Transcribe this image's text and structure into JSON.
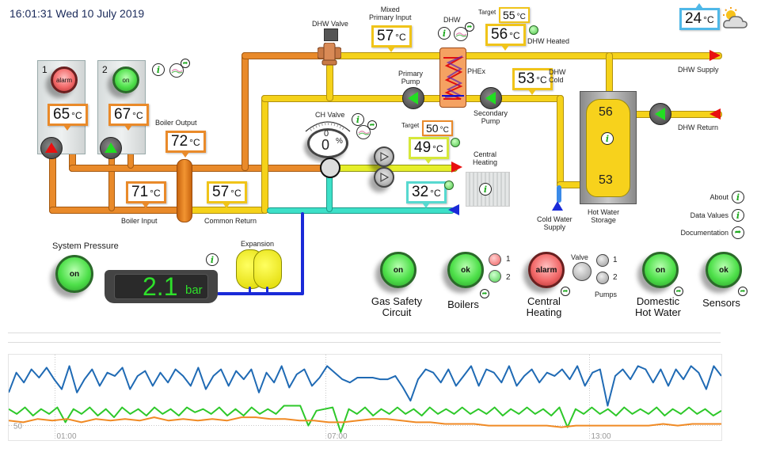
{
  "header": {
    "datetime": "16:01:31 Wed 10 July 2019"
  },
  "weather": {
    "outdoor_temp": "24",
    "unit": "°C",
    "icon": "partly-cloudy-icon"
  },
  "boilers": [
    {
      "number": "1",
      "status": "alarm",
      "temp": "65",
      "unit": "°C",
      "pump": "red-up"
    },
    {
      "number": "2",
      "status": "on",
      "temp": "67",
      "unit": "°C",
      "pump": "green-up"
    }
  ],
  "labels": {
    "boiler_output": "Boiler Output",
    "boiler_input": "Boiler Input",
    "common_return": "Common Return",
    "dhw_valve": "DHW Valve",
    "mixed_primary_input": "Mixed\nPrimary Input",
    "dhw": "DHW",
    "target": "Target",
    "dhw_heated": "DHW Heated",
    "phex": "PHEx",
    "primary_pump": "Primary\nPump",
    "secondary_pump": "Secondary\nPump",
    "dhw_cold": "DHW\nCold",
    "dhw_supply": "DHW Supply",
    "dhw_return": "DHW Return",
    "ch_valve": "CH Valve",
    "central_heating": "Central\nHeating",
    "cold_water_supply": "Cold Water\nSupply",
    "hot_water_storage": "Hot Water\nStorage",
    "expansion": "Expansion",
    "system_pressure": "System Pressure"
  },
  "temps": {
    "boiler_output": "72",
    "boiler_input": "71",
    "common_return": "57",
    "mixed_primary_input": "57",
    "dhw_target": "55",
    "dhw_out": "56",
    "dhw_cold": "53",
    "ch_target": "50",
    "ch_flow": "49",
    "ch_return": "32",
    "tank_top": "56",
    "tank_bottom": "53",
    "unit": "°C"
  },
  "ch_valve": {
    "value_small": "0",
    "value": "0",
    "unit": "%"
  },
  "pressure": {
    "status": "on",
    "value": "2.1",
    "unit": "bar"
  },
  "links": {
    "about": "About",
    "data_values": "Data Values",
    "documentation": "Documentation"
  },
  "status_panel": {
    "gas_safety": {
      "status": "on",
      "label": "Gas Safety\nCircuit"
    },
    "boilers": {
      "status": "ok",
      "label": "Boilers",
      "sub": [
        {
          "n": "1",
          "state": "red"
        },
        {
          "n": "2",
          "state": "green"
        }
      ]
    },
    "central_heating": {
      "status": "alarm",
      "label": "Central\nHeating",
      "valve_label": "Valve",
      "pumps_label": "Pumps",
      "pumps": [
        {
          "n": "1"
        },
        {
          "n": "2"
        }
      ]
    },
    "domestic_hot_water": {
      "status": "on",
      "label": "Domestic\nHot Water"
    },
    "sensors": {
      "status": "ok",
      "label": "Sensors"
    }
  },
  "colors": {
    "boiler_pipe": "#e98a2a",
    "primary_pipe": "#f5d21a",
    "ch_flow_pipe": "#e6ef2a",
    "ch_return_pipe": "#3de0c8",
    "cold_pipe": "#1a2ad8",
    "ok_green": "#4ee04a",
    "alarm_red": "#f26a6a"
  },
  "chart_data": {
    "type": "line",
    "title": "",
    "xlabel": "",
    "ylabel": "",
    "x_tick_labels": [
      "01:00",
      "07:00",
      "13:00"
    ],
    "y_tick_labels": [
      "50"
    ],
    "grid": true,
    "series": [
      {
        "name": "blue",
        "color": "#1f6ab4",
        "values": [
          70,
          82,
          76,
          84,
          79,
          85,
          78,
          72,
          86,
          70,
          78,
          84,
          74,
          82,
          80,
          85,
          72,
          80,
          83,
          74,
          82,
          76,
          84,
          80,
          74,
          85,
          72,
          80,
          84,
          74,
          83,
          78,
          84,
          70,
          82,
          76,
          86,
          73,
          81,
          84,
          74,
          79,
          86,
          82,
          78,
          76,
          79,
          79,
          79,
          78,
          78,
          80,
          73,
          65,
          78,
          84,
          82,
          76,
          84,
          74,
          80,
          86,
          74,
          84,
          82,
          76,
          86,
          74,
          80,
          84,
          76,
          82,
          80,
          84,
          78,
          86,
          74,
          82,
          84,
          62,
          80,
          84,
          78,
          86,
          84,
          76,
          84,
          74,
          84,
          78,
          86,
          82,
          72,
          86,
          80
        ]
      },
      {
        "name": "green",
        "color": "#2ec82a",
        "values": [
          60,
          57,
          61,
          56,
          60,
          57,
          61,
          52,
          60,
          57,
          61,
          56,
          60,
          55,
          61,
          57,
          60,
          56,
          61,
          57,
          60,
          56,
          61,
          58,
          60,
          57,
          61,
          56,
          60,
          56,
          61,
          57,
          60,
          57,
          62,
          62,
          62,
          50,
          59,
          60,
          61,
          46,
          60,
          57,
          61,
          56,
          60,
          57,
          61,
          57,
          60,
          56,
          61,
          57,
          60,
          57,
          61,
          57,
          60,
          57,
          61,
          56,
          60,
          57,
          61,
          57,
          60,
          56,
          61,
          49,
          60,
          57,
          61,
          57,
          60,
          56,
          61,
          57,
          60,
          57,
          61,
          56,
          60,
          57,
          61,
          57,
          60,
          56,
          59
        ]
      },
      {
        "name": "orange",
        "color": "#f08a24",
        "values": [
          53,
          52,
          54,
          53,
          54,
          52,
          54,
          53,
          54,
          53,
          55,
          53,
          54,
          53,
          54,
          53,
          55,
          55,
          54,
          54,
          53,
          53,
          52,
          52,
          53,
          54,
          54,
          53,
          52,
          52,
          51,
          51,
          51,
          50,
          50,
          50,
          50,
          50,
          49,
          50,
          50,
          50,
          50,
          50,
          50,
          51,
          50,
          51,
          51,
          51
        ]
      }
    ]
  }
}
